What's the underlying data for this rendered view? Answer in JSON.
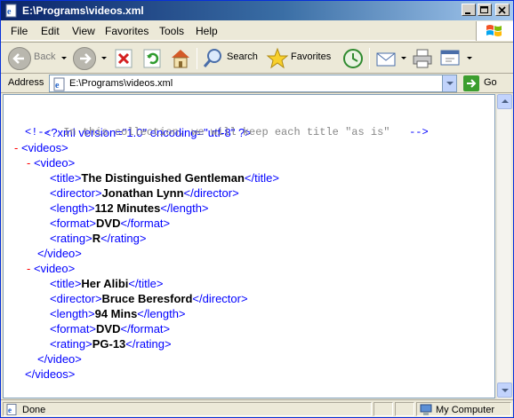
{
  "window": {
    "title": "E:\\Programs\\videos.xml"
  },
  "menu": [
    "File",
    "Edit",
    "View",
    "Favorites",
    "Tools",
    "Help"
  ],
  "toolbar": {
    "back_label": "Back",
    "search_label": "Search",
    "favorites_label": "Favorites"
  },
  "address": {
    "label": "Address",
    "value": "E:\\Programs\\videos.xml",
    "go_label": "Go"
  },
  "xml": {
    "declaration": "<?xml version=\"1.0\" encoding=\"utf-8\" ?>",
    "comment_open": "<!--",
    "comment_text": "  In this collection, we will keep each title \"as is\"   ",
    "comment_close": "-->",
    "root_open": "<videos>",
    "root_close": "</videos>",
    "videos": [
      {
        "title": "The Distinguished Gentleman",
        "director": "Jonathan Lynn",
        "length": "112 Minutes",
        "format": "DVD",
        "rating": "R"
      },
      {
        "title": "Her Alibi",
        "director": "Bruce Beresford",
        "length": "94 Mins",
        "format": "DVD",
        "rating": "PG-13"
      }
    ]
  },
  "tags": {
    "video_open": "<video>",
    "video_close": "</video>",
    "title_open": "<title>",
    "title_close": "</title>",
    "director_open": "<director>",
    "director_close": "</director>",
    "length_open": "<length>",
    "length_close": "</length>",
    "format_open": "<format>",
    "format_close": "</format>",
    "rating_open": "<rating>",
    "rating_close": "</rating>",
    "minus": "-"
  },
  "status": {
    "text": "Done",
    "zone": "My Computer"
  },
  "colors": {
    "tag": "#0000ff",
    "minus": "#ff0000",
    "comment": "#888888",
    "titlebar_start": "#0a246a",
    "titlebar_end": "#a6caf0"
  }
}
